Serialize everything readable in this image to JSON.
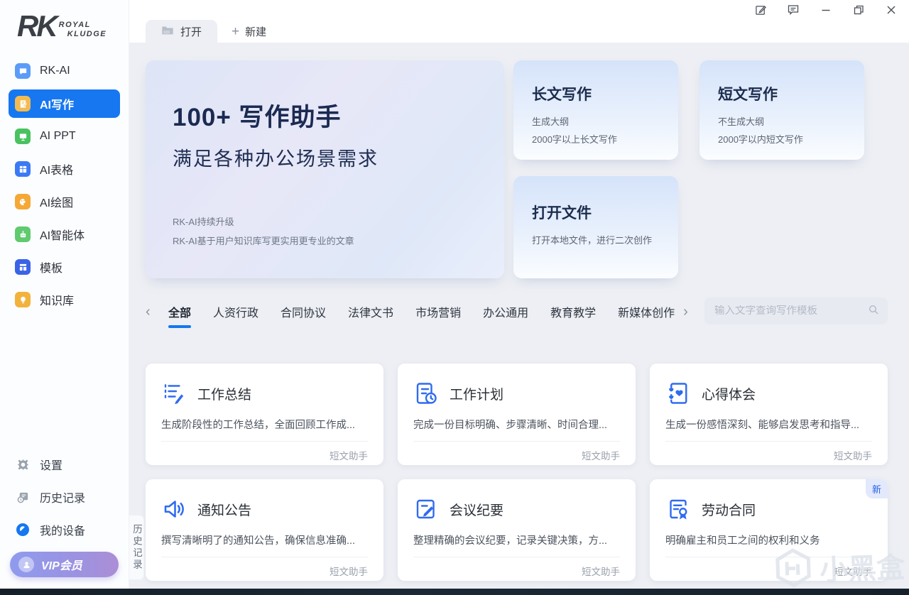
{
  "titlebar": {
    "open_tab": "打开",
    "new_tab": "新建"
  },
  "sidebar": {
    "logo": {
      "mark": "RK",
      "name_line1": "ROYAL",
      "name_line2": "KLUDGE"
    },
    "items": [
      {
        "label": "RK-AI",
        "icon": "chat-icon",
        "color": "#5b9cf8",
        "active": false
      },
      {
        "label": "AI写作",
        "icon": "writing-icon",
        "color": "#f2bb52",
        "active": true
      },
      {
        "label": "AI PPT",
        "icon": "ppt-icon",
        "color": "#49c25f",
        "active": false
      },
      {
        "label": "AI表格",
        "icon": "table-icon",
        "color": "#3b7af5",
        "active": false
      },
      {
        "label": "AI绘图",
        "icon": "paint-icon",
        "color": "#f5a836",
        "active": false
      },
      {
        "label": "AI智能体",
        "icon": "agent-icon",
        "color": "#5fca6e",
        "active": false
      },
      {
        "label": "模板",
        "icon": "template-icon",
        "color": "#3a63e8",
        "active": false
      },
      {
        "label": "知识库",
        "icon": "knowledge-icon",
        "color": "#f2b23c",
        "active": false
      }
    ],
    "footer_items": [
      {
        "label": "设置",
        "icon": "gear-icon"
      },
      {
        "label": "历史记录",
        "icon": "history-icon"
      },
      {
        "label": "我的设备",
        "icon": "device-icon"
      }
    ],
    "vip_label": "VIP会员"
  },
  "hero": {
    "title": "100+ 写作助手",
    "subtitle": "满足各种办公场景需求",
    "note1": "RK-AI持续升级",
    "note2": "RK-AI基于用户知识库写更实用更专业的文章"
  },
  "quick_cards": [
    {
      "title": "长文写作",
      "line1": "生成大纲",
      "line2": "2000字以上长文写作"
    },
    {
      "title": "短文写作",
      "line1": "不生成大纲",
      "line2": "2000字以内短文写作"
    },
    {
      "title": "打开文件",
      "line1": "打开本地文件，进行二次创作",
      "line2": ""
    }
  ],
  "categories": {
    "prev": "‹",
    "next": "›",
    "tabs": [
      "全部",
      "人资行政",
      "合同协议",
      "法律文书",
      "市场营销",
      "办公通用",
      "教育教学",
      "新媒体创作"
    ],
    "active": "全部"
  },
  "search": {
    "placeholder": "输入文字查询写作模板"
  },
  "templates": [
    {
      "title": "工作总结",
      "icon": "summary-icon",
      "desc": "生成阶段性的工作总结，全面回顾工作成...",
      "tag": "短文助手"
    },
    {
      "title": "工作计划",
      "icon": "plan-icon",
      "desc": "完成一份目标明确、步骤清晰、时间合理...",
      "tag": "短文助手"
    },
    {
      "title": "心得体会",
      "icon": "insight-icon",
      "desc": "生成一份感悟深刻、能够启发思考和指导...",
      "tag": "短文助手"
    },
    {
      "title": "通知公告",
      "icon": "speaker-icon",
      "desc": "撰写清晰明了的通知公告，确保信息准确...",
      "tag": "短文助手"
    },
    {
      "title": "会议纪要",
      "icon": "minutes-icon",
      "desc": "整理精确的会议纪要，记录关键决策，方...",
      "tag": "短文助手"
    },
    {
      "title": "劳动合同",
      "icon": "contract-icon",
      "desc": "明确雇主和员工之间的权利和义务",
      "tag": "短文助手",
      "badge": "新"
    }
  ],
  "side_panel_tab": "历史记录",
  "watermark": "小黑盒",
  "colors": {
    "accent": "#1677f0",
    "content_bg": "#edeff4",
    "vip_gradient_start": "#8f9bee",
    "vip_gradient_end": "#ab8ed6",
    "badge_bg": "#e3e9fc",
    "badge_text": "#2460e8"
  }
}
